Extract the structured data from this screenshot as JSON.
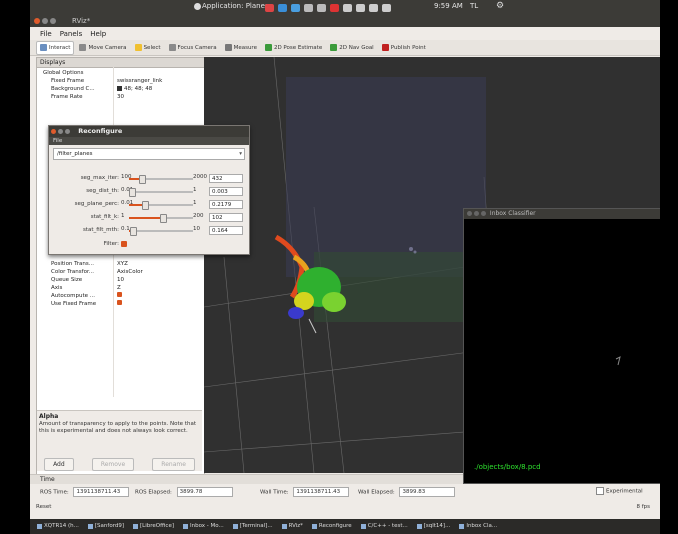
{
  "os_panel": {
    "app_title": "Application: Planes",
    "clock": "9:59 AM",
    "user": "TL"
  },
  "window": {
    "title": "RViz*",
    "menu": [
      "File",
      "Panels",
      "Help"
    ]
  },
  "toolbar": {
    "items": [
      {
        "label": "Interact",
        "icon": "interact-icon",
        "color": "#6a8fc0",
        "active": true
      },
      {
        "label": "Move Camera",
        "icon": "move-camera-icon",
        "color": "#8a8a8a"
      },
      {
        "label": "Select",
        "icon": "select-icon",
        "color": "#f0c030"
      },
      {
        "label": "Focus Camera",
        "icon": "focus-camera-icon",
        "color": "#8a8a8a"
      },
      {
        "label": "Measure",
        "icon": "measure-icon",
        "color": "#777"
      },
      {
        "label": "2D Pose Estimate",
        "icon": "pose-estimate-icon",
        "color": "#3a9a3a"
      },
      {
        "label": "2D Nav Goal",
        "icon": "nav-goal-icon",
        "color": "#3a9a3a"
      },
      {
        "label": "Publish Point",
        "icon": "publish-point-icon",
        "color": "#c02020"
      }
    ]
  },
  "displays_panel": {
    "header": "Displays",
    "rows": [
      {
        "key": "Global Options",
        "value": "",
        "indent": 0
      },
      {
        "key": "Fixed Frame",
        "value": "swissranger_link",
        "indent": 1
      },
      {
        "key": "Background C...",
        "value": "48; 48; 48",
        "swatch": "#303030",
        "indent": 1
      },
      {
        "key": "Frame Rate",
        "value": "30",
        "indent": 1
      }
    ],
    "props_rows": [
      {
        "key": "Position Trans...",
        "value": "XYZ"
      },
      {
        "key": "Color Transfor...",
        "value": "AxisColor"
      },
      {
        "key": "Queue Size",
        "value": "10"
      },
      {
        "key": "Axis",
        "value": "Z"
      },
      {
        "key": "Autocompute ...",
        "value": "",
        "checkbox": true
      },
      {
        "key": "Use Fixed Frame",
        "value": "",
        "checkbox": true
      }
    ],
    "alpha_title": "Alpha",
    "alpha_desc": "Amount of transparency to apply to the points. Note that this is experimental and does not always look correct.",
    "buttons": [
      {
        "label": "Add",
        "enabled": true
      },
      {
        "label": "Remove",
        "enabled": false
      },
      {
        "label": "Rename",
        "enabled": false
      }
    ]
  },
  "reconfigure": {
    "title": "Reconfigure",
    "menu": "File",
    "node": "/filter_planes",
    "params": [
      {
        "name": "seg_max_iter:",
        "min": "100",
        "max": "2000",
        "value": "432",
        "fraction": 0.17
      },
      {
        "name": "seg_dist_th:",
        "min": "0.01",
        "max": "1",
        "value": "0.003",
        "fraction": 0.0
      },
      {
        "name": "seg_plane_perc:",
        "min": "0.01",
        "max": "1",
        "value": "0.2179",
        "fraction": 0.21
      },
      {
        "name": "stat_filt_k:",
        "min": "1",
        "max": "200",
        "value": "102",
        "fraction": 0.51
      },
      {
        "name": "stat_filt_mth:",
        "min": "0.1",
        "max": "10",
        "value": "0.164",
        "fraction": 0.01
      }
    ],
    "filter_label": "Filter:"
  },
  "viewer": {
    "title": "Inbox Classifier",
    "path": "./objects/box/8.pcd"
  },
  "time_panel": {
    "header": "Time",
    "fields": [
      {
        "label": "ROS Time:",
        "value": "1391138711.43"
      },
      {
        "label": "ROS Elapsed:",
        "value": "3899.78"
      },
      {
        "label": "Wall Time:",
        "value": "1391138711.43"
      },
      {
        "label": "Wall Elapsed:",
        "value": "3899.83"
      }
    ],
    "experimental": "Experimental",
    "reset": "Reset",
    "fps": "8 fps"
  },
  "taskbar": {
    "items": [
      "XQTR14 (h...",
      "[Sanford9]",
      "[LibreOffice]",
      "Inbox - Mo...",
      "[Terminal]...",
      "RViz*",
      "Reconfigure",
      "C/C++ - test...",
      "[sqlt14]...",
      "Inbox Cla..."
    ]
  }
}
